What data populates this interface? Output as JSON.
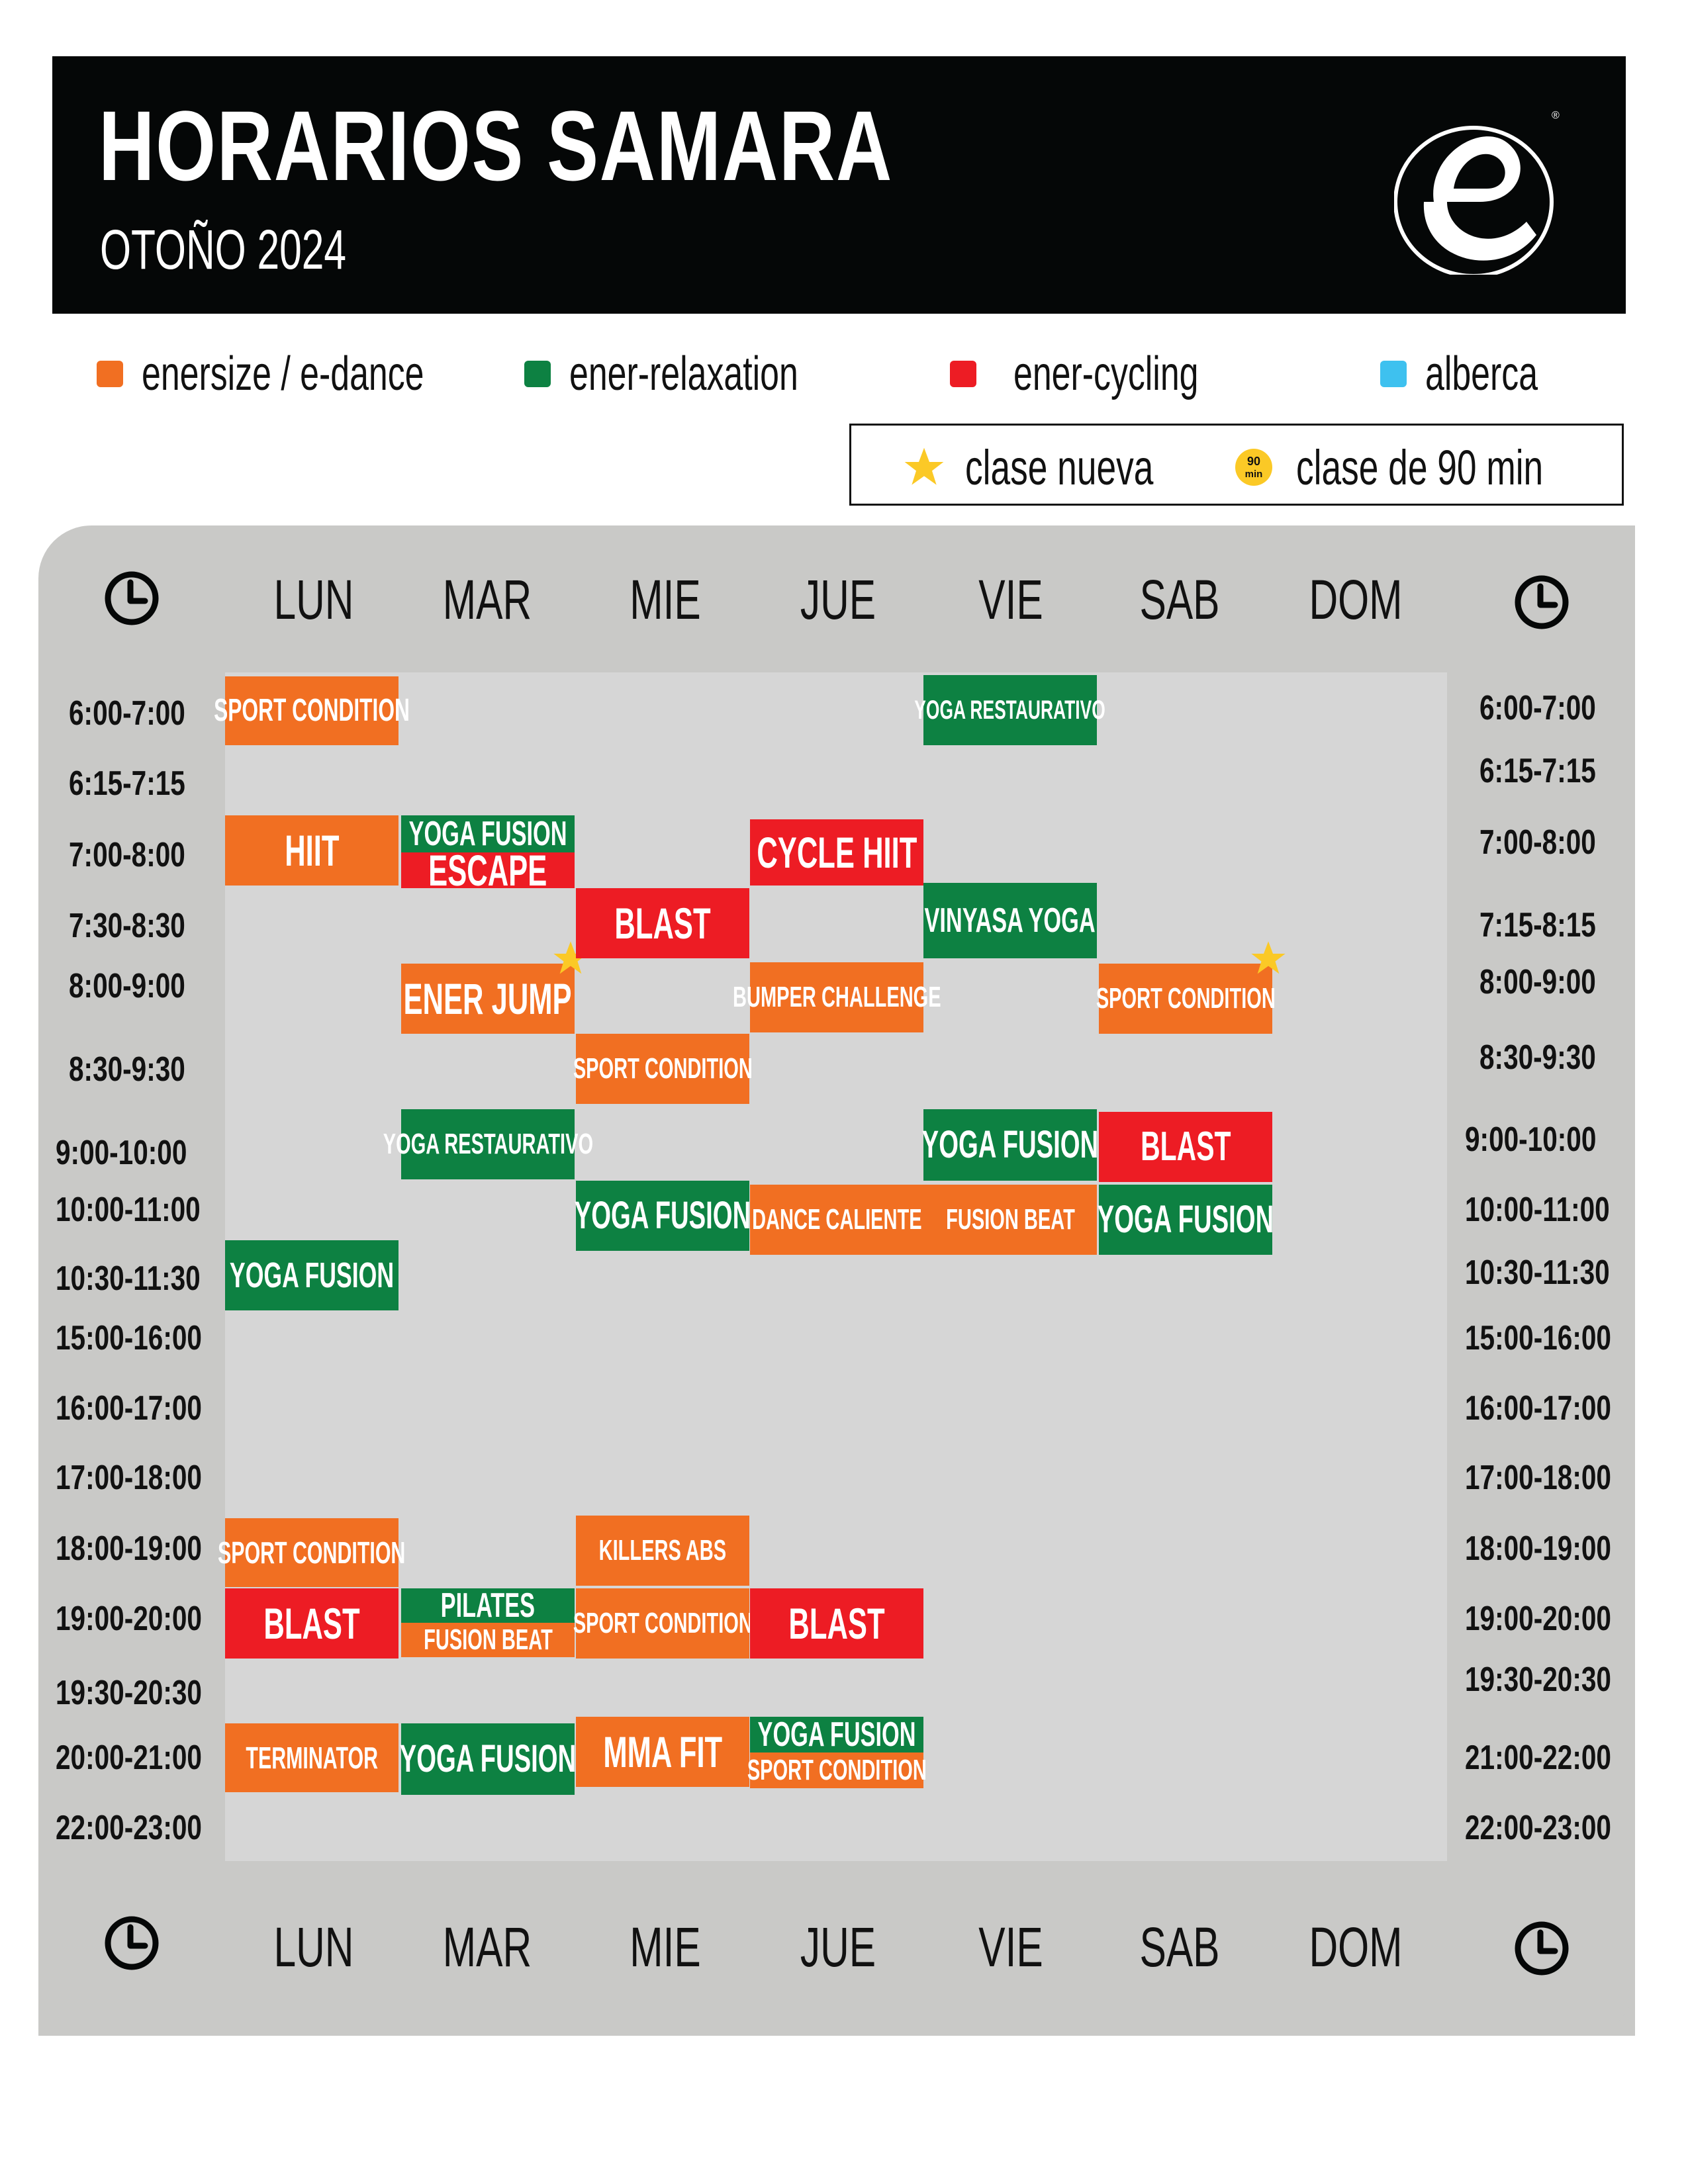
{
  "header": {
    "title": "HORARIOS SAMARA",
    "subtitle": "OTOÑO 2024",
    "logo": "e-logo-icon",
    "registered_mark": "®"
  },
  "legend": {
    "categories": [
      {
        "label": "enersize / e-dance",
        "color": "#f16f22"
      },
      {
        "label": "ener-relaxation",
        "color": "#0d8142"
      },
      {
        "label": "ener-cycling",
        "color": "#ed1c24"
      },
      {
        "label": "alberca",
        "color": "#3ec1ef"
      }
    ],
    "markers": [
      {
        "icon": "star-icon",
        "label": "clase nueva",
        "color": "#fbc926"
      },
      {
        "icon": "90-min-badge-icon",
        "badge_top": "90",
        "badge_bottom": "min",
        "label": "clase de 90 min",
        "color": "#fbc926"
      }
    ]
  },
  "schedule": {
    "days_top": [
      "LUN",
      "MAR",
      "MIE",
      "JUE",
      "VIE",
      "SAB",
      "DOM"
    ],
    "days_bottom": [
      "LUN",
      "MAR",
      "MIE",
      "JUE",
      "VIE",
      "SAB",
      "DOM"
    ],
    "times_left": [
      "6:00-7:00",
      "6:15-7:15",
      "7:00-8:00",
      "7:30-8:30",
      "8:00-9:00",
      "8:30-9:30",
      "9:00-10:00",
      "10:00-11:00",
      "10:30-11:30",
      "15:00-16:00",
      "16:00-17:00",
      "17:00-18:00",
      "18:00-19:00",
      "19:00-20:00",
      "19:30-20:30",
      "20:00-21:00",
      "22:00-23:00"
    ],
    "times_right": [
      "6:00-7:00",
      "6:15-7:15",
      "7:00-8:00",
      "7:15-8:15",
      "8:00-9:00",
      "8:30-9:30",
      "9:00-10:00",
      "10:00-11:00",
      "10:30-11:30",
      "15:00-16:00",
      "16:00-17:00",
      "17:00-18:00",
      "18:00-19:00",
      "19:00-20:00",
      "19:30-20:30",
      "21:00-22:00",
      "22:00-23:00"
    ],
    "classes": [
      {
        "day": "LUN",
        "time": "6:00-7:00",
        "name": "SPORT CONDITION",
        "category": "enersize / e-dance"
      },
      {
        "day": "LUN",
        "time": "7:00-8:00",
        "name": "HIIT",
        "category": "enersize / e-dance"
      },
      {
        "day": "LUN",
        "time": "10:30-11:30",
        "name": "YOGA FUSION",
        "category": "ener-relaxation"
      },
      {
        "day": "LUN",
        "time": "18:00-19:00",
        "name": "SPORT CONDITION",
        "category": "enersize / e-dance"
      },
      {
        "day": "LUN",
        "time": "19:00-20:00",
        "name": "BLAST",
        "category": "ener-cycling"
      },
      {
        "day": "LUN",
        "time": "20:00-21:00",
        "name": "TERMINATOR",
        "category": "enersize / e-dance"
      },
      {
        "day": "MAR",
        "time": "7:00-8:00",
        "name": "YOGA FUSION",
        "category": "ener-relaxation"
      },
      {
        "day": "MAR",
        "time": "7:00-8:00",
        "name": "ESCAPE",
        "category": "ener-cycling"
      },
      {
        "day": "MAR",
        "time": "8:00-9:00",
        "name": "ENER JUMP",
        "category": "enersize / e-dance",
        "new": true
      },
      {
        "day": "MAR",
        "time": "9:00-10:00",
        "name": "YOGA RESTAURATIVO",
        "category": "ener-relaxation"
      },
      {
        "day": "MAR",
        "time": "19:00-20:00",
        "name": "PILATES",
        "category": "ener-relaxation"
      },
      {
        "day": "MAR",
        "time": "19:00-20:00",
        "name": "FUSION BEAT",
        "category": "enersize / e-dance"
      },
      {
        "day": "MAR",
        "time": "20:00-21:00",
        "name": "YOGA FUSION",
        "category": "ener-relaxation"
      },
      {
        "day": "MIE",
        "time": "7:30-8:30",
        "name": "BLAST",
        "category": "ener-cycling"
      },
      {
        "day": "MIE",
        "time": "8:30-9:30",
        "name": "SPORT CONDITION",
        "category": "enersize / e-dance"
      },
      {
        "day": "MIE",
        "time": "10:00-11:00",
        "name": "YOGA FUSION",
        "category": "ener-relaxation"
      },
      {
        "day": "MIE",
        "time": "18:00-19:00",
        "name": "KILLERS ABS",
        "category": "enersize / e-dance"
      },
      {
        "day": "MIE",
        "time": "19:00-20:00",
        "name": "SPORT CONDITION",
        "category": "enersize / e-dance"
      },
      {
        "day": "MIE",
        "time": "20:00-21:00",
        "name": "MMA FIT",
        "category": "enersize / e-dance"
      },
      {
        "day": "JUE",
        "time": "7:00-8:00",
        "name": "CYCLE HIIT",
        "category": "ener-cycling"
      },
      {
        "day": "JUE",
        "time": "8:00-9:00",
        "name": "BUMPER CHALLENGE",
        "category": "enersize / e-dance"
      },
      {
        "day": "JUE",
        "time": "10:00-11:00",
        "name": "DANCE CALIENTE",
        "category": "enersize / e-dance"
      },
      {
        "day": "JUE",
        "time": "19:00-20:00",
        "name": "BLAST",
        "category": "ener-cycling"
      },
      {
        "day": "JUE",
        "time": "20:00-21:00",
        "name": "YOGA FUSION",
        "category": "ener-relaxation"
      },
      {
        "day": "JUE",
        "time": "20:00-21:00",
        "name": "SPORT CONDITION",
        "category": "enersize / e-dance"
      },
      {
        "day": "VIE",
        "time": "6:00-7:00",
        "name": "YOGA RESTAURATIVO",
        "category": "ener-relaxation"
      },
      {
        "day": "VIE",
        "time": "7:15-8:15",
        "name": "VINYASA YOGA",
        "category": "ener-relaxation"
      },
      {
        "day": "VIE",
        "time": "9:00-10:00",
        "name": "YOGA FUSION",
        "category": "ener-relaxation"
      },
      {
        "day": "VIE",
        "time": "10:00-11:00",
        "name": "FUSION BEAT",
        "category": "enersize / e-dance"
      },
      {
        "day": "SAB",
        "time": "8:00-9:00",
        "name": "SPORT CONDITION",
        "category": "enersize / e-dance",
        "new": true
      },
      {
        "day": "SAB",
        "time": "9:00-10:00",
        "name": "BLAST",
        "category": "ener-cycling"
      },
      {
        "day": "SAB",
        "time": "10:00-11:00",
        "name": "YOGA FUSION",
        "category": "ener-relaxation"
      }
    ]
  }
}
